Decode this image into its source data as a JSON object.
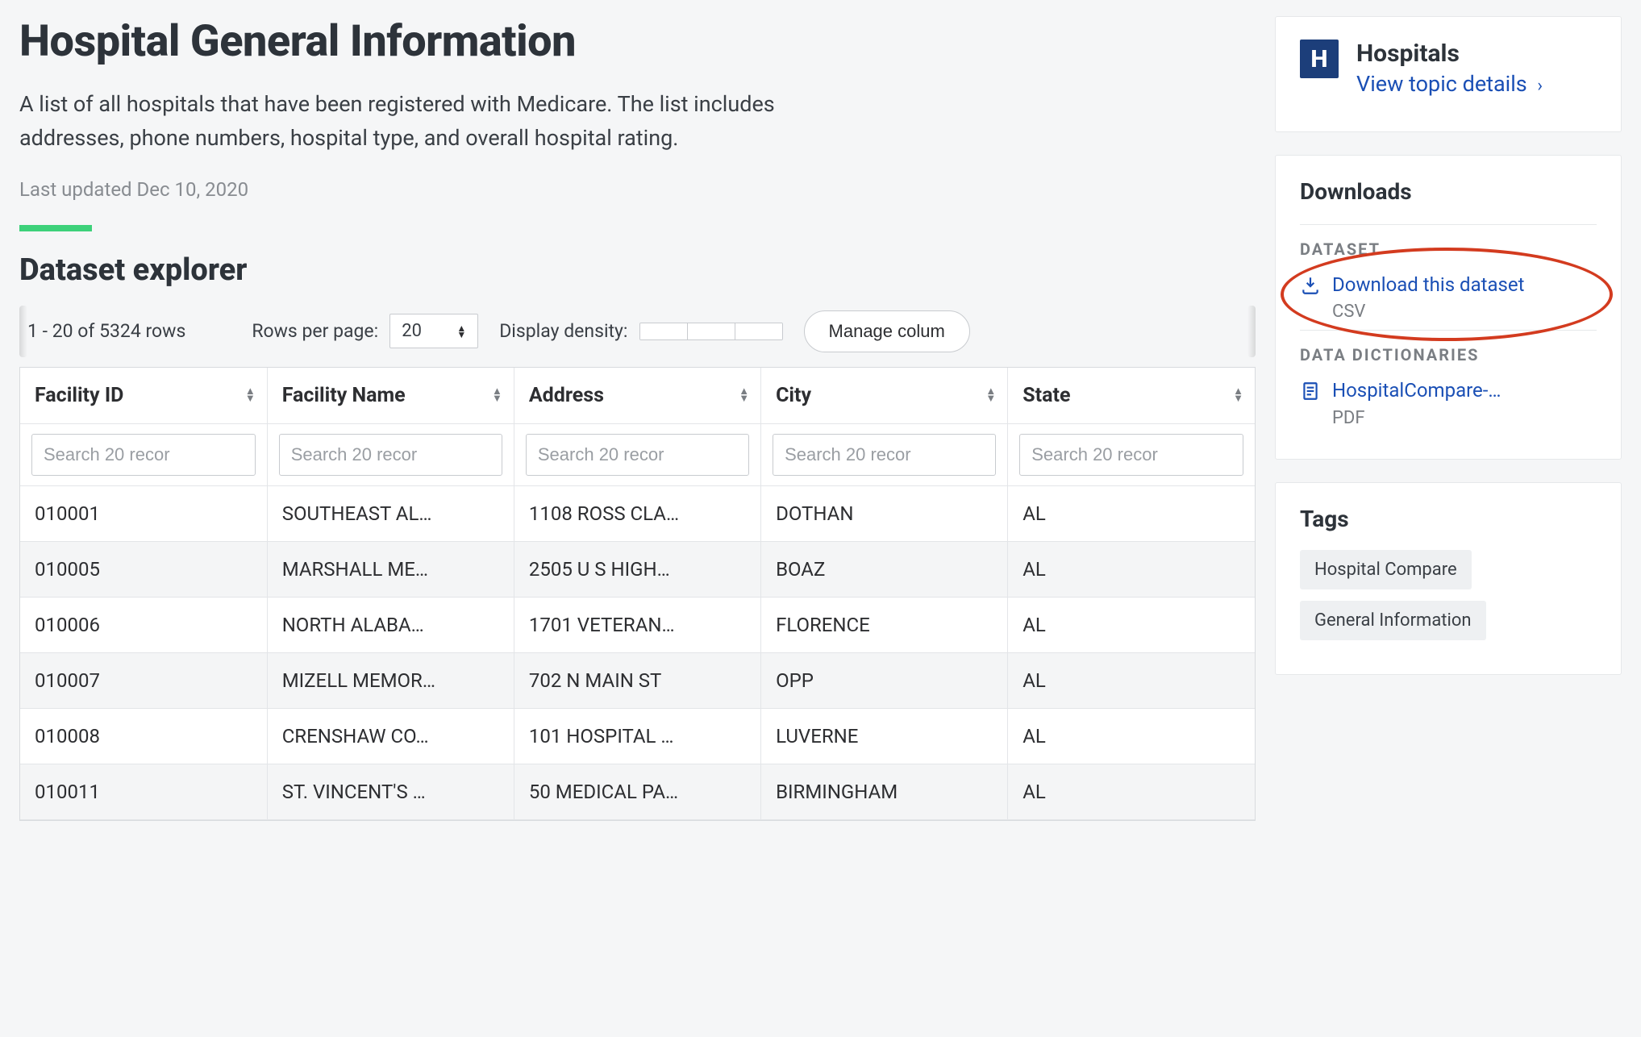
{
  "header": {
    "title": "Hospital General Information",
    "description": "A list of all hospitals that have been registered with Medicare. The list includes addresses, phone numbers, hospital type, and overall hospital rating.",
    "last_updated": "Last updated Dec 10, 2020"
  },
  "explorer": {
    "heading": "Dataset explorer",
    "pagination_text": "1 - 20  of  5324 rows",
    "rows_per_page_label": "Rows per page:",
    "rows_per_page_value": "20",
    "display_density_label": "Display density:",
    "manage_columns_label": "Manage colum"
  },
  "columns": [
    {
      "label": "Facility ID",
      "search_placeholder": "Search 20 recor"
    },
    {
      "label": "Facility Name",
      "search_placeholder": "Search 20 recor"
    },
    {
      "label": "Address",
      "search_placeholder": "Search 20 recor"
    },
    {
      "label": "City",
      "search_placeholder": "Search 20 recor"
    },
    {
      "label": "State",
      "search_placeholder": "Search 20 recor"
    }
  ],
  "rows": [
    {
      "facility_id": "010001",
      "facility_name": "SOUTHEAST AL…",
      "address": "1108 ROSS CLA…",
      "city": "DOTHAN",
      "state": "AL"
    },
    {
      "facility_id": "010005",
      "facility_name": "MARSHALL ME…",
      "address": "2505 U S HIGH…",
      "city": "BOAZ",
      "state": "AL"
    },
    {
      "facility_id": "010006",
      "facility_name": "NORTH ALABA…",
      "address": "1701 VETERAN…",
      "city": "FLORENCE",
      "state": "AL"
    },
    {
      "facility_id": "010007",
      "facility_name": "MIZELL MEMOR…",
      "address": "702 N MAIN ST",
      "city": "OPP",
      "state": "AL"
    },
    {
      "facility_id": "010008",
      "facility_name": "CRENSHAW CO…",
      "address": "101 HOSPITAL …",
      "city": "LUVERNE",
      "state": "AL"
    },
    {
      "facility_id": "010011",
      "facility_name": "ST. VINCENT'S …",
      "address": "50 MEDICAL PA…",
      "city": "BIRMINGHAM",
      "state": "AL"
    }
  ],
  "sidebar": {
    "topic": {
      "icon_letter": "H",
      "title": "Hospitals",
      "link_text": "View topic details"
    },
    "downloads": {
      "heading": "Downloads",
      "dataset_label": "DATASET",
      "dataset_link": "Download this dataset",
      "dataset_format": "CSV",
      "dict_label": "DATA DICTIONARIES",
      "dict_link": "HospitalCompare-…",
      "dict_format": "PDF"
    },
    "tags": {
      "heading": "Tags",
      "items": [
        "Hospital Compare",
        "General Information"
      ]
    }
  }
}
